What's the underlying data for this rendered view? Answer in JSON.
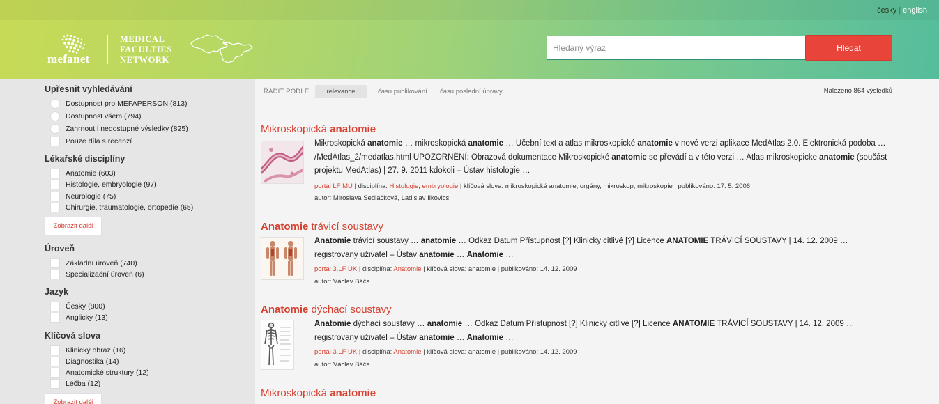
{
  "header": {
    "lang": {
      "cz": "česky",
      "sep": "|",
      "en": "english"
    },
    "logo": {
      "brand": "mefanet",
      "line1": "MEDICAL",
      "line2": "FACULTIES",
      "line3": "NETWORK"
    },
    "search": {
      "placeholder": "Hledaný výraz",
      "button": "Hledat"
    }
  },
  "sidebar": {
    "refine": {
      "title": "Upřesnit vyhledávání",
      "options": [
        "Dostupnost pro MEFAPERSON (813)",
        "Dostupnost všem (794)",
        "Zahrnout i nedostupné výsledky (825)",
        "Pouze díla s recenzí"
      ]
    },
    "disciplines": {
      "title": "Lékařské disciplíny",
      "options": [
        "Anatomie (603)",
        "Histologie, embryologie (97)",
        "Neurologie (75)",
        "Chirurgie, traumatologie, ortopedie (65)"
      ],
      "more": "Zobrazit další"
    },
    "level": {
      "title": "Úroveň",
      "options": [
        "Základní úroveň (740)",
        "Specializační úroveň (6)"
      ]
    },
    "language": {
      "title": "Jazyk",
      "options": [
        "Česky (800)",
        "Anglicky (13)"
      ]
    },
    "keywords": {
      "title": "Klíčová slova",
      "options": [
        "Klinický obraz (16)",
        "Diagnostika (14)",
        "Anatomické struktury (12)",
        "Léčba (12)"
      ],
      "more": "Zobrazit další"
    }
  },
  "sort": {
    "label": "ŘADIT PODLE",
    "relevance": "relevance",
    "published": "času publikování",
    "modified": "času poslední úpravy",
    "found": "Nalezeno 864 výsledků"
  },
  "results": [
    {
      "title_a": "Mikroskopická ",
      "title_b": "anatomie",
      "s1": "Mikroskopická ",
      "s2": "anatomie",
      "s3": " … mikroskopická ",
      "s4": "anatomie",
      "s5": " … Učební text a atlas mikroskopické ",
      "s6": "anatomie",
      "s7": " v nové verzi aplikace MedAtlas 2.0. Elektronická podoba … /MedAtlas_2/medatlas.html UPOZORNĚNÍ: Obrazová dokumentace Mikroskopické ",
      "s8": "anatomie",
      "s9": " se převádí a v této verzi … Atlas mikroskopicke ",
      "s10": "anatomie",
      "s11": " (součást projektu MedAtlas) | 27. 9. 2011 kdokoli – Ústav histologie …",
      "portal": "portál LF MU",
      "disc_label": " | disciplína: ",
      "disc": "Histologie",
      "disc_sep": ", ",
      "disc2": "embryologie",
      "rest": " | klíčová slova: mikroskopická anatomie, orgány, mikroskop, mikroskopie | publikováno: 17. 5. 2006",
      "author": "autor: Miroslava Sedláčková, Ladislav Ilkovics"
    },
    {
      "title_a": "Anatomie",
      "title_b": " trávicí soustavy",
      "s1": "Anatomie",
      "s2": " trávicí soustavy … ",
      "s3": "anatomie",
      "s4": " … Odkaz Datum Přístupnost [?] Klinicky citlivé [?] Licence ",
      "s5": "ANATOMIE",
      "s6": " TRÁVICÍ SOUSTAVY | 14. 12. 2009 … registrovaný uživatel – Ústav ",
      "s7": "anatomie",
      "s8": " … ",
      "s9": "Anatomie",
      "s10": " …",
      "portal": "portál 3.LF UK",
      "disc_label": " | disciplína: ",
      "disc": "Anatomie",
      "rest": " | klíčová slova: anatomie | publikováno: 14. 12. 2009",
      "author": "autor: Václav Báča"
    },
    {
      "title_a": "Anatomie",
      "title_b": " dýchací soustavy",
      "s1": "Anatomie",
      "s2": " dýchací soustavy … ",
      "s3": "anatomie",
      "s4": " … Odkaz Datum Přístupnost [?] Klinicky citlivé [?] Licence ",
      "s5": "ANATOMIE",
      "s6": " TRÁVICÍ SOUSTAVY | 14. 12. 2009 … registrovaný uživatel – Ústav ",
      "s7": "anatomie",
      "s8": " … ",
      "s9": "Anatomie",
      "s10": " …",
      "portal": "portál 3.LF UK",
      "disc_label": " | disciplína: ",
      "disc": "Anatomie",
      "rest": " | klíčová slova: anatomie | publikováno: 14. 12. 2009",
      "author": "autor: Václav Báča"
    },
    {
      "title_a": "Mikroskopická ",
      "title_b": "anatomie"
    }
  ],
  "colors": {
    "accent_red": "#e8443a",
    "link_red": "#d6402f",
    "header_start": "#c7da56",
    "header_end": "#55bd9c"
  },
  "icons": [
    "mefanet-dots-logo",
    "czech-slovak-map-icon",
    "checkbox-icon"
  ]
}
